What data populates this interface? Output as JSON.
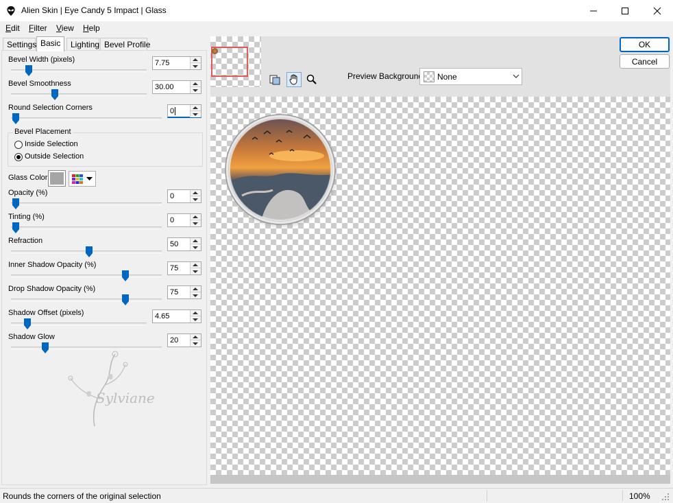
{
  "window": {
    "title": "Alien Skin | Eye Candy 5 Impact | Glass"
  },
  "menu": [
    {
      "label": "Edit",
      "accel": "E",
      "rest": "dit"
    },
    {
      "label": "Filter",
      "accel": "F",
      "rest": "ilter"
    },
    {
      "label": "View",
      "accel": "V",
      "rest": "iew"
    },
    {
      "label": "Help",
      "accel": "H",
      "rest": "elp"
    }
  ],
  "tabs": [
    "Settings",
    "Basic",
    "Lighting",
    "Bevel Profile"
  ],
  "active_tab": "Basic",
  "controls": {
    "bevel_width": {
      "label": "Bevel Width (pixels)",
      "value": "7.75",
      "level": 0.06
    },
    "bevel_smoothness": {
      "label": "Bevel Smoothness",
      "value": "30.00",
      "level": 0.3
    },
    "round_corners": {
      "label": "Round Selection Corners",
      "value": "0",
      "level": 0.0
    },
    "opacity": {
      "label": "Opacity (%)",
      "value": "0",
      "level": 0.0
    },
    "tinting": {
      "label": "Tinting (%)",
      "value": "0",
      "level": 0.0
    },
    "refraction": {
      "label": "Refraction",
      "value": "50",
      "level": 0.5
    },
    "inner_shadow": {
      "label": "Inner Shadow Opacity (%)",
      "value": "75",
      "level": 0.75
    },
    "drop_shadow": {
      "label": "Drop Shadow Opacity (%)",
      "value": "75",
      "level": 0.75
    },
    "shadow_offset": {
      "label": "Shadow Offset (pixels)",
      "value": "4.65",
      "level": 0.05
    },
    "shadow_glow": {
      "label": "Shadow Glow",
      "value": "20",
      "level": 0.2
    }
  },
  "bevel_placement": {
    "group_label": "Bevel Placement",
    "options": [
      "Inside Selection",
      "Outside Selection"
    ],
    "selected": "Outside Selection"
  },
  "glass_color": {
    "label": "Glass Color",
    "swatch": "#a5a5a5"
  },
  "watermark": "Sylviane",
  "buttons": {
    "ok": "OK",
    "cancel": "Cancel"
  },
  "preview_background": {
    "label": "Preview Background:",
    "value": "None"
  },
  "status": {
    "hint": "Rounds the corners of the original selection",
    "zoom": "100%"
  },
  "colors": {
    "accent": "#0067c0",
    "nav_frame": "#e05a5a"
  }
}
